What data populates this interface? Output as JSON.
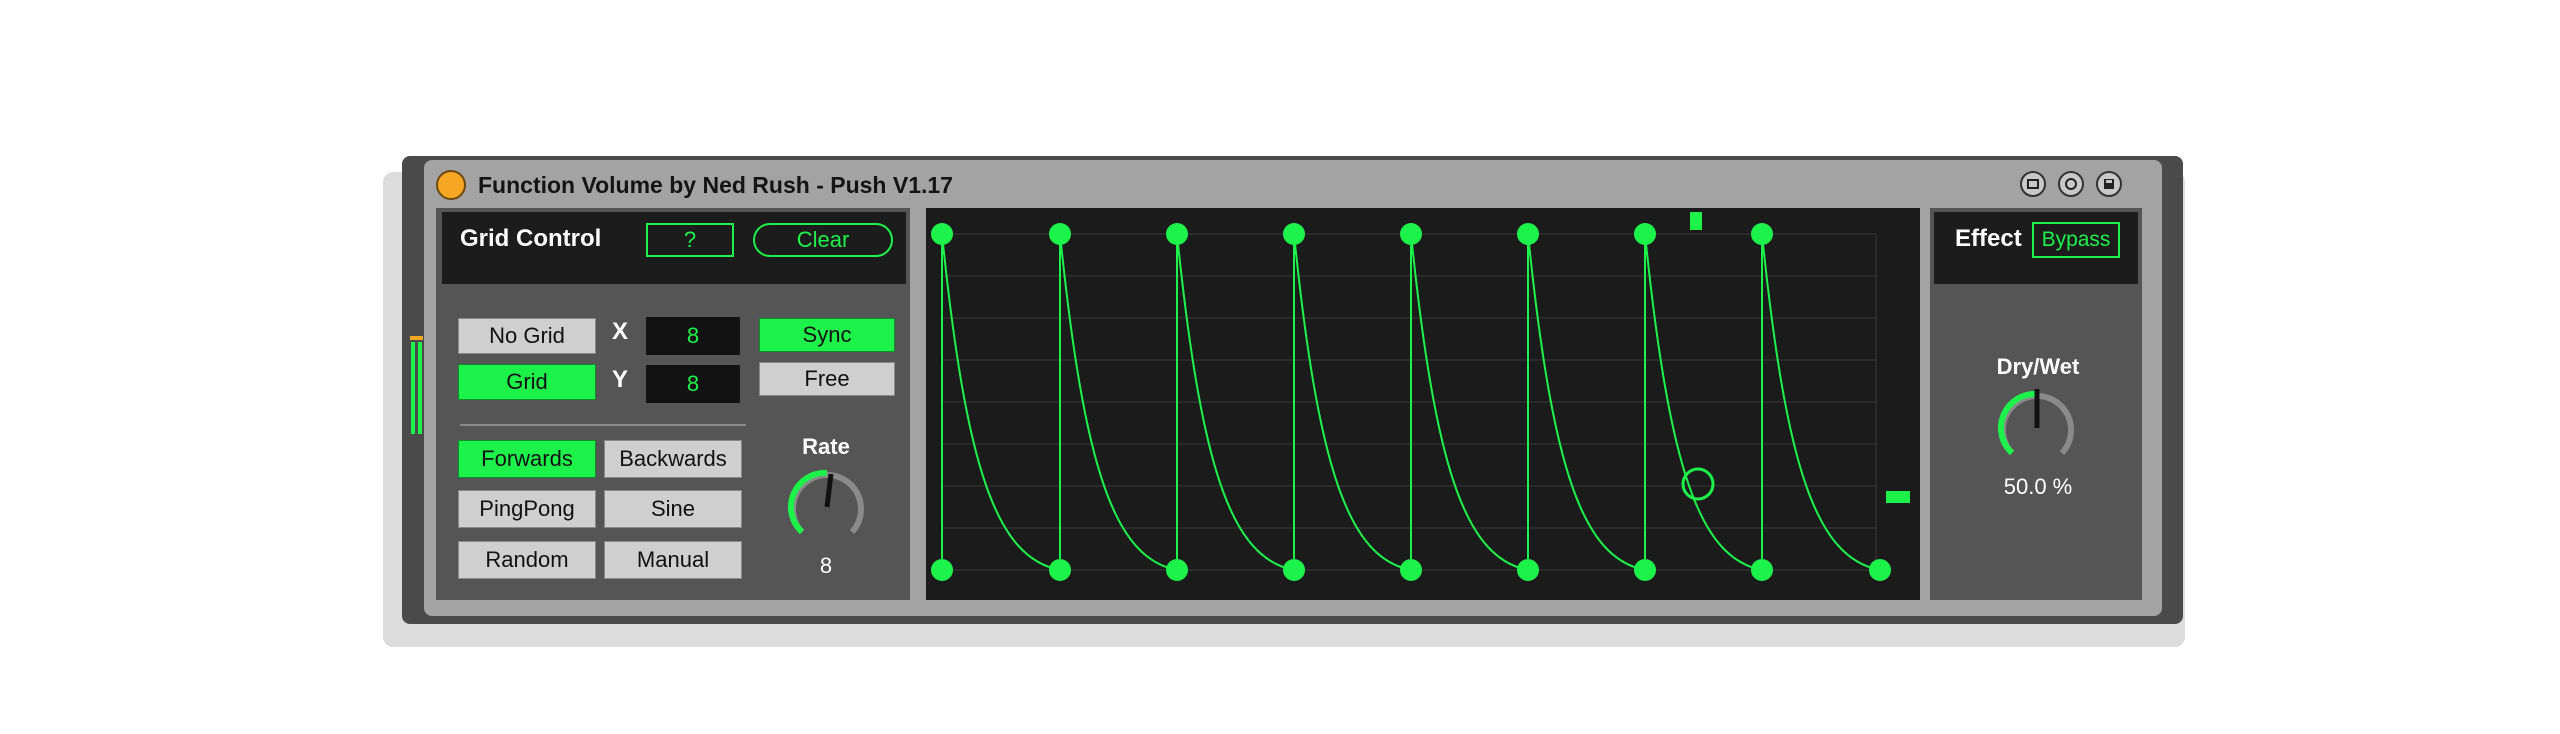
{
  "window": {
    "title": "Function Volume by Ned Rush - Push V1.17",
    "icons": [
      "clip-icon",
      "refresh-icon",
      "save-icon"
    ]
  },
  "grid_control": {
    "header": "Grid Control",
    "help_label": "?",
    "clear_label": "Clear",
    "no_grid_label": "No Grid",
    "grid_label": "Grid",
    "x_label": "X",
    "x_value": "8",
    "y_label": "Y",
    "y_value": "8",
    "sync_label": "Sync",
    "free_label": "Free",
    "modes": {
      "forwards": "Forwards",
      "backwards": "Backwards",
      "pingpong": "PingPong",
      "sine": "Sine",
      "random": "Random",
      "manual": "Manual"
    },
    "rate_label": "Rate",
    "rate_value": "8"
  },
  "effect": {
    "header": "Effect",
    "bypass_label": "Bypass",
    "drywet_label": "Dry/Wet",
    "drywet_value": "50.0 %"
  },
  "colors": {
    "accent": "#1df24b",
    "panel": "#555555",
    "dark": "#1b1b1b"
  }
}
